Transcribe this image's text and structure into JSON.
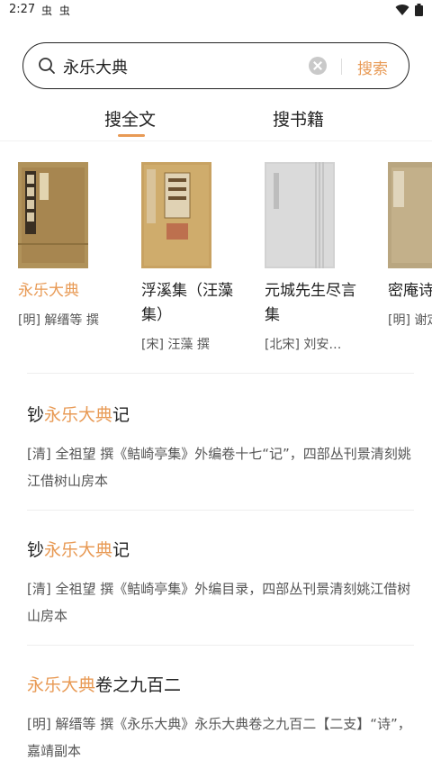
{
  "status": {
    "time": "2:27",
    "notifications": "虫 虫"
  },
  "search": {
    "query": "永乐大典",
    "button_label": "搜索"
  },
  "tabs": [
    {
      "label": "搜全文",
      "active": true
    },
    {
      "label": "搜书籍",
      "active": false
    }
  ],
  "colors": {
    "accent": "#e89a55"
  },
  "books": [
    {
      "title": "永乐大典",
      "author": "[明] 解缙等 撰",
      "highlight": true
    },
    {
      "title": "浮溪集（汪藻集）",
      "author": "[宋] 汪藻 撰"
    },
    {
      "title": "元城先生尽言集",
      "author": "[北宋] 刘安…"
    },
    {
      "title": "密庵诗（谢赤",
      "author": "[明] 谢定"
    }
  ],
  "results": [
    {
      "prefix": "钞",
      "highlight": "永乐大典",
      "suffix": "记",
      "desc": "[清] 全祖望 撰《鲒崎亭集》外编卷十七“记”，四部丛刊景清刻姚江借树山房本"
    },
    {
      "prefix": "钞",
      "highlight": "永乐大典",
      "suffix": "记",
      "desc": "[清] 全祖望 撰《鲒崎亭集》外编目录，四部丛刊景清刻姚江借树山房本"
    },
    {
      "prefix": "",
      "highlight": "永乐大典",
      "suffix": "卷之九百二",
      "desc": "[明] 解缙等 撰《永乐大典》永乐大典卷之九百二【二支】“诗”，嘉靖副本"
    }
  ]
}
